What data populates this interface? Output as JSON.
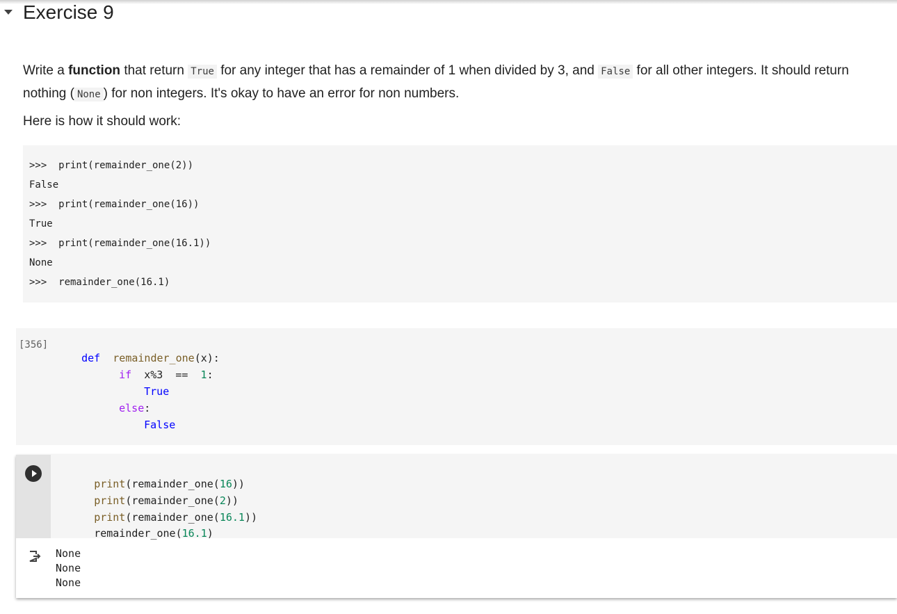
{
  "section": {
    "title": "Exercise 9"
  },
  "description": {
    "p1_a": "Write a ",
    "p1_b": "function",
    "p1_c": " that return ",
    "p1_code1": "True",
    "p1_d": " for any integer that has a remainder of 1 when divided by 3, and ",
    "p1_code2": "False",
    "p1_e": " for all other integers. It should return",
    "p2_a": "nothing (",
    "p2_code": "None",
    "p2_b": ") for non integers. It's okay to have an error for non numbers.",
    "p3": "Here is how it should work:"
  },
  "example_lines": [
    ">>>  print(remainder_one(2))",
    "False",
    ">>>  print(remainder_one(16))",
    "True",
    ">>>  print(remainder_one(16.1))",
    "None",
    ">>>  remainder_one(16.1)"
  ],
  "cell1": {
    "exec_count": "[356]",
    "def_kw": "def",
    "fn_name": "remainder_one",
    "fn_sig": "(x):",
    "if_kw": "if",
    "cond_a": "x%3",
    "cond_op": "==",
    "cond_num": "1",
    "cond_colon": ":",
    "true_kw": "True",
    "else_kw": "else",
    "else_colon": ":",
    "false_kw": "False"
  },
  "cell2": {
    "lines": [
      {
        "fn": "print",
        "open": "(remainder_one(",
        "num": "16",
        "close": "))"
      },
      {
        "fn": "print",
        "open": "(remainder_one(",
        "num": "2",
        "close": "))"
      },
      {
        "fn": "print",
        "open": "(remainder_one(",
        "num": "16.1",
        "close": "))"
      },
      {
        "fn": "",
        "open": "remainder_one(",
        "num": "16.1",
        "close": ")"
      }
    ],
    "outputs": [
      "None",
      "None",
      "None"
    ]
  }
}
